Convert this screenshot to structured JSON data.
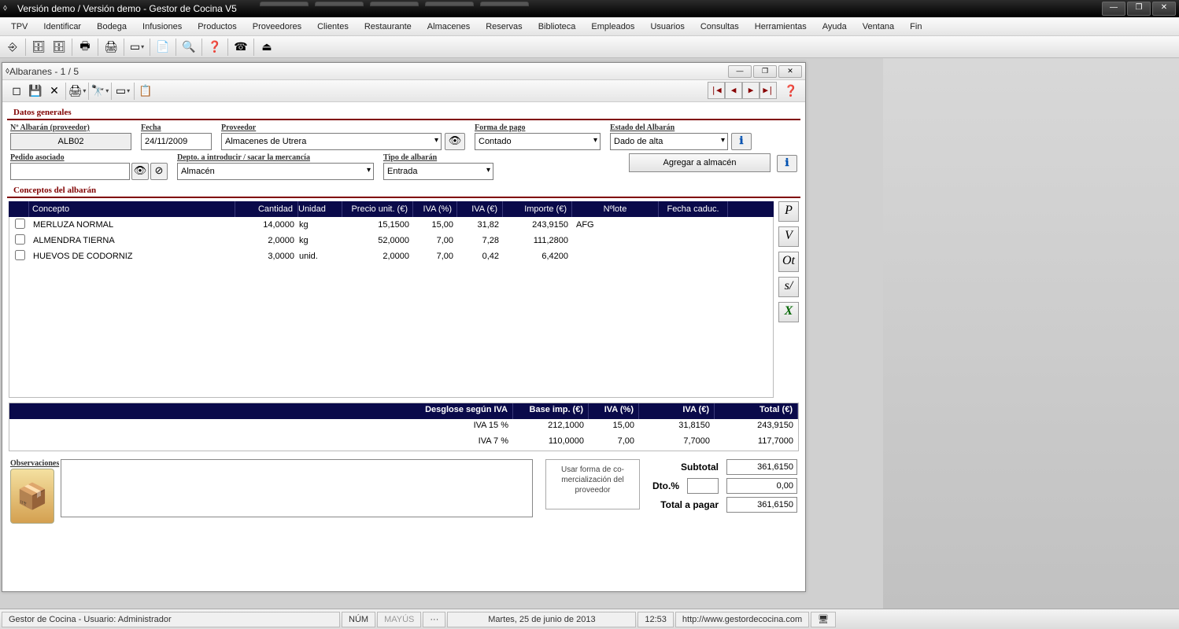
{
  "titlebar": "Versión demo / Versión demo - Gestor de Cocina V5",
  "menubar": [
    "TPV",
    "Identificar",
    "Bodega",
    "Infusiones",
    "Productos",
    "Proveedores",
    "Clientes",
    "Restaurante",
    "Almacenes",
    "Reservas",
    "Biblioteca",
    "Empleados",
    "Usuarios",
    "Consultas",
    "Herramientas",
    "Ayuda",
    "Ventana",
    "Fin"
  ],
  "childTitle": "Albaranes - 1 / 5",
  "section1": "Datos generales",
  "section2": "Conceptos del albarán",
  "labels": {
    "numAlbaran": "Nº Albarán (proveedor)",
    "fecha": "Fecha",
    "proveedor": "Proveedor",
    "formaPago": "Forma de pago",
    "estado": "Estado del Albarán",
    "pedido": "Pedido asociado",
    "depto": "Depto. a introducir / sacar la mercancía",
    "tipo": "Tipo de albarán",
    "agregar": "Agregar a almacén",
    "observaciones": "Observaciones",
    "comerc": "Usar forma de co-\nmercialización del\nproveedor",
    "subtotal": "Subtotal",
    "dto": "Dto.%",
    "total": "Total a pagar"
  },
  "values": {
    "numAlbaran": "ALB02",
    "fecha": "24/11/2009",
    "proveedor": "Almacenes de Utrera",
    "formaPago": "Contado",
    "estado": "Dado de alta",
    "pedido": "",
    "depto": "Almacén",
    "tipo": "Entrada",
    "dtoInput": "",
    "subtotal": "361,6150",
    "dtoVal": "0,00",
    "total": "361,6150"
  },
  "gridHeaders": [
    "Concepto",
    "Cantidad",
    "Unidad",
    "Precio unit. (€)",
    "IVA (%)",
    "IVA (€)",
    "Importe (€)",
    "Nºlote",
    "Fecha caduc."
  ],
  "rows": [
    {
      "concepto": "MERLUZA NORMAL",
      "cantidad": "14,0000",
      "unidad": "kg",
      "precio": "15,1500",
      "ivap": "15,00",
      "ivae": "31,82",
      "importe": "243,9150",
      "lote": "AFG",
      "caduc": ""
    },
    {
      "concepto": "ALMENDRA TIERNA",
      "cantidad": "2,0000",
      "unidad": "kg",
      "precio": "52,0000",
      "ivap": "7,00",
      "ivae": "7,28",
      "importe": "111,2800",
      "lote": "",
      "caduc": ""
    },
    {
      "concepto": "HUEVOS DE CODORNIZ",
      "cantidad": "3,0000",
      "unidad": "unid.",
      "precio": "2,0000",
      "ivap": "7,00",
      "ivae": "0,42",
      "importe": "6,4200",
      "lote": "",
      "caduc": ""
    }
  ],
  "ivaHeaders": [
    "Desglose según IVA",
    "Base imp. (€)",
    "IVA (%)",
    "IVA (€)",
    "Total (€)"
  ],
  "ivaRows": [
    {
      "label": "IVA 15 %",
      "base": "212,1000",
      "pct": "15,00",
      "iva": "31,8150",
      "total": "243,9150"
    },
    {
      "label": "IVA 7 %",
      "base": "110,0000",
      "pct": "7,00",
      "iva": "7,7000",
      "total": "117,7000"
    }
  ],
  "sideBtns": [
    "P",
    "V",
    "Ot",
    "s/",
    "X"
  ],
  "navBtns": [
    "|◀",
    "◀",
    "▶",
    "▶|"
  ],
  "statusbar": {
    "user": "Gestor de Cocina - Usuario: Administrador",
    "num": "NÚM",
    "mayus": "MAYÚS",
    "dots": "···",
    "date": "Martes, 25 de junio de 2013",
    "time": "12:53",
    "url": "http://www.gestordecocina.com"
  }
}
